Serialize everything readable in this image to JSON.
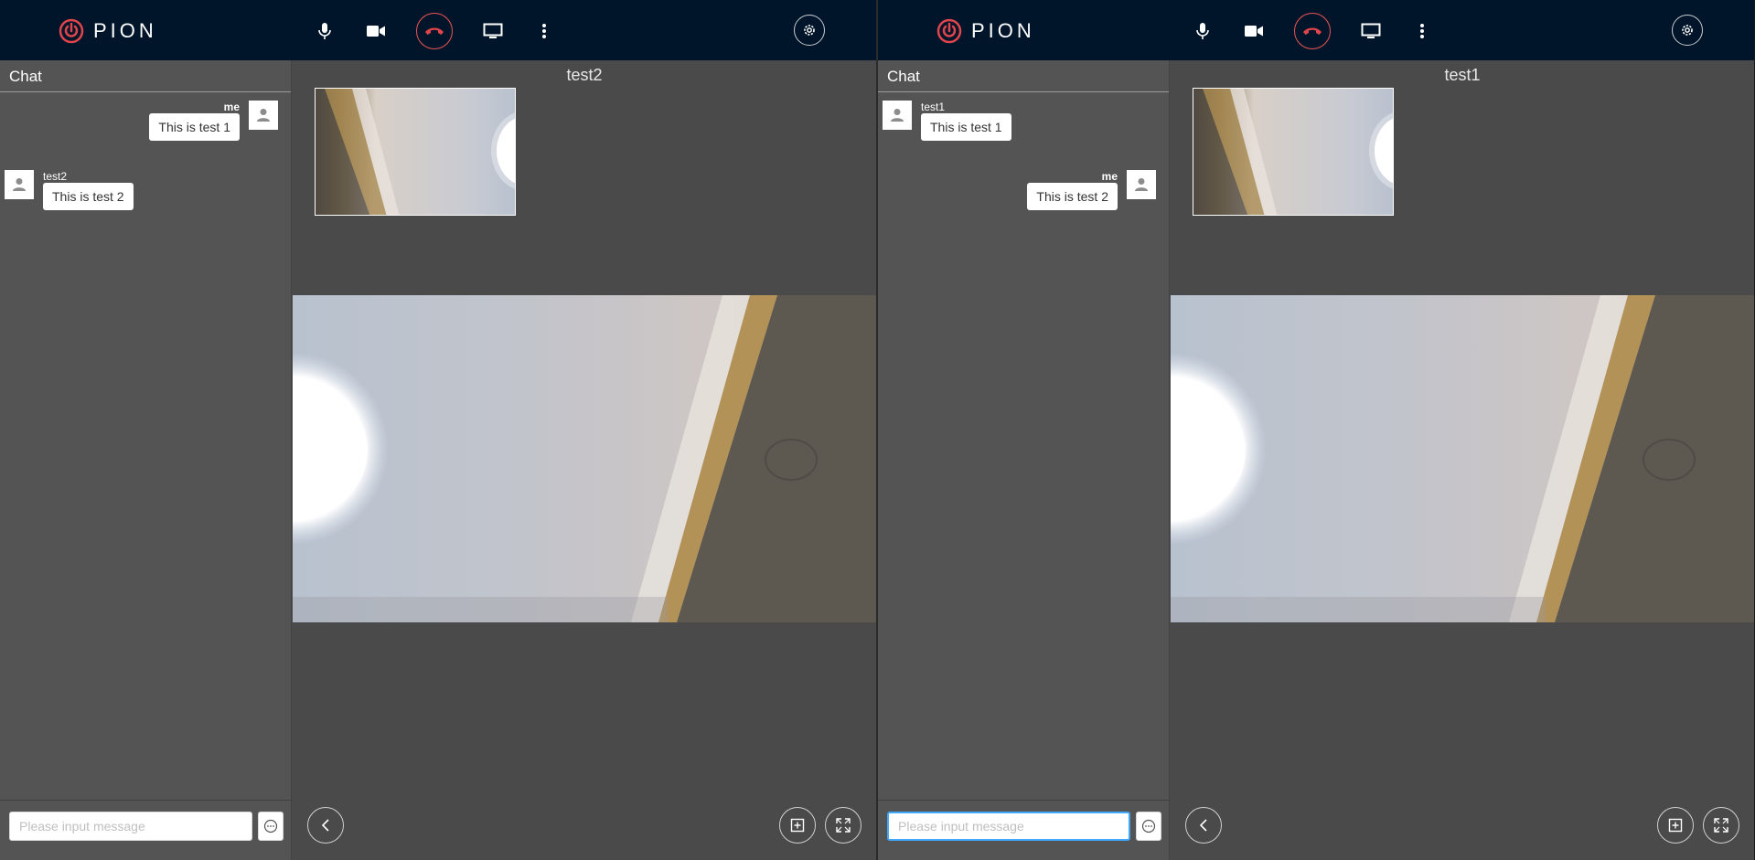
{
  "brand": {
    "name": "PION",
    "accent": "#e0454c",
    "header_bg": "#001529"
  },
  "icons": {
    "mic": "microphone-icon",
    "camera": "video-camera-icon",
    "hangup": "phone-hangup-icon",
    "screen": "desktop-icon",
    "more": "more-vertical-icon",
    "settings": "gear-icon",
    "avatar": "user-icon",
    "send": "message-icon",
    "back": "chevron-left-icon",
    "add": "plus-square-icon",
    "fullscreen": "fullscreen-icon"
  },
  "windows": [
    {
      "chat": {
        "title": "Chat",
        "messages": [
          {
            "side": "right",
            "sender": "me",
            "text": "This is test 1"
          },
          {
            "side": "left",
            "sender": "test2",
            "text": "This is test 2"
          }
        ],
        "input": {
          "value": "",
          "placeholder": "Please input message",
          "focused": false
        }
      },
      "peer_name": "test2"
    },
    {
      "chat": {
        "title": "Chat",
        "messages": [
          {
            "side": "left",
            "sender": "test1",
            "text": "This is test 1"
          },
          {
            "side": "right",
            "sender": "me",
            "text": "This is test 2"
          }
        ],
        "input": {
          "value": "",
          "placeholder": "Please input message",
          "focused": true
        }
      },
      "peer_name": "test1"
    }
  ]
}
